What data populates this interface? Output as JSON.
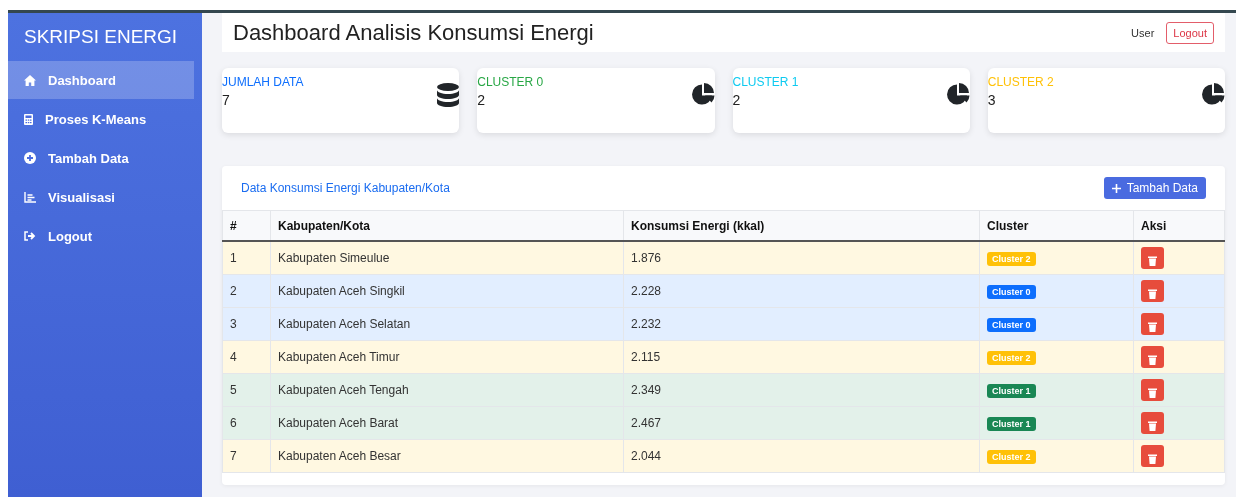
{
  "sidebar": {
    "brand": "SKRIPSI ENERGI",
    "items": [
      {
        "label": "Dashboard",
        "kind": "home",
        "selected": true
      },
      {
        "label": "Proses K-Means",
        "kind": "calculator",
        "selected": false
      },
      {
        "label": "Tambah Data",
        "kind": "add",
        "selected": false
      },
      {
        "label": "Visualisasi",
        "kind": "chart",
        "selected": false
      },
      {
        "label": "Logout",
        "kind": "logout",
        "selected": false
      }
    ]
  },
  "header": {
    "title": "Dashboard Analisis Konsumsi Energi",
    "user": "User",
    "logout": "Logout"
  },
  "stats": [
    {
      "label": "JUMLAH DATA",
      "value": "7",
      "color": "#0d6efd",
      "kind": "database"
    },
    {
      "label": "CLUSTER 0",
      "value": "2",
      "color": "#28a745",
      "kind": "pie"
    },
    {
      "label": "CLUSTER 1",
      "value": "2",
      "color": "#0dcaf0",
      "kind": "pie"
    },
    {
      "label": "CLUSTER 2",
      "value": "3",
      "color": "#ffc107",
      "kind": "pie"
    }
  ],
  "table": {
    "title": "Data Konsumsi Energi Kabupaten/Kota",
    "add_button": "Tambah Data",
    "columns": [
      "#",
      "Kabupaten/Kota",
      "Konsumsi Energi (kkal)",
      "Cluster",
      "Aksi"
    ],
    "rows": [
      {
        "no": "1",
        "name": "Kabupaten Simeulue",
        "value": "1.876",
        "cluster": "Cluster 2",
        "color": "#ffc107"
      },
      {
        "no": "2",
        "name": "Kabupaten Aceh Singkil",
        "value": "2.228",
        "cluster": "Cluster 0",
        "color": "#0d6efd"
      },
      {
        "no": "3",
        "name": "Kabupaten Aceh Selatan",
        "value": "2.232",
        "cluster": "Cluster 0",
        "color": "#0d6efd"
      },
      {
        "no": "4",
        "name": "Kabupaten Aceh Timur",
        "value": "2.115",
        "cluster": "Cluster 2",
        "color": "#ffc107"
      },
      {
        "no": "5",
        "name": "Kabupaten Aceh Tengah",
        "value": "2.349",
        "cluster": "Cluster 1",
        "color": "#198754"
      },
      {
        "no": "6",
        "name": "Kabupaten Aceh Barat",
        "value": "2.467",
        "cluster": "Cluster 1",
        "color": "#198754"
      },
      {
        "no": "7",
        "name": "Kabupaten Aceh Besar",
        "value": "2.044",
        "cluster": "Cluster 2",
        "color": "#ffc107"
      }
    ]
  }
}
